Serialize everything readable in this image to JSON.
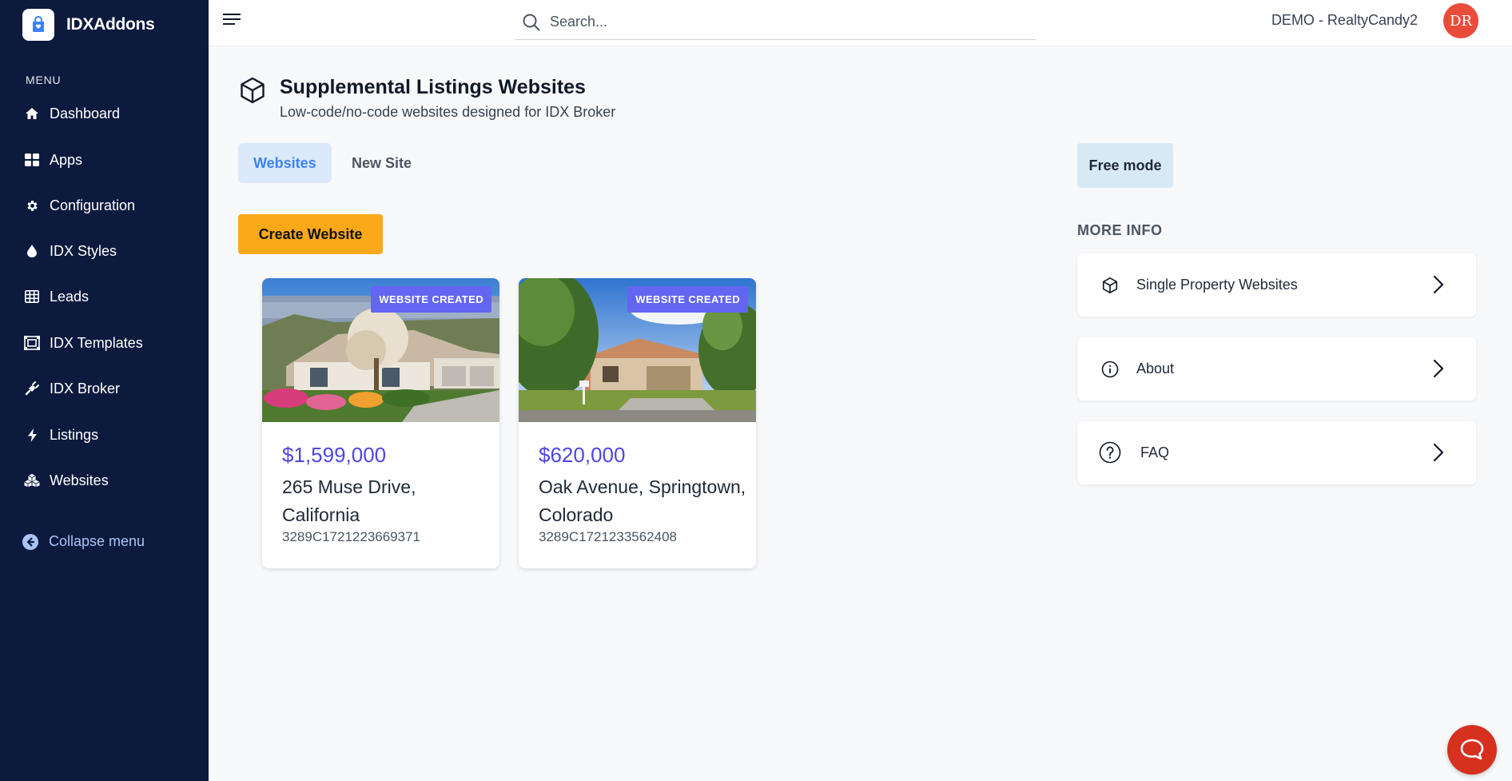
{
  "brand": {
    "name": "IDXAddons"
  },
  "sidebar": {
    "menu_title": "MENU",
    "items": [
      {
        "label": "Dashboard",
        "icon": "home-icon"
      },
      {
        "label": "Apps",
        "icon": "grid-icon"
      },
      {
        "label": "Configuration",
        "icon": "gear-icon"
      },
      {
        "label": "IDX Styles",
        "icon": "droplet-icon"
      },
      {
        "label": "Leads",
        "icon": "table-icon"
      },
      {
        "label": "IDX Templates",
        "icon": "template-icon"
      },
      {
        "label": "IDX Broker",
        "icon": "plug-icon"
      },
      {
        "label": "Listings",
        "icon": "bolt-icon"
      },
      {
        "label": "Websites",
        "icon": "cubes-icon"
      }
    ],
    "collapse_label": "Collapse menu"
  },
  "topbar": {
    "search_placeholder": "Search...",
    "account_name": "DEMO - RealtyCandy2",
    "avatar_initials": "DR"
  },
  "header": {
    "title": "Supplemental Listings Websites",
    "subtitle": "Low-code/no-code websites designed for IDX Broker"
  },
  "tabs": [
    {
      "label": "Websites",
      "active": true
    },
    {
      "label": "New Site",
      "active": false
    }
  ],
  "create_button": "Create Website",
  "cards": [
    {
      "badge": "WEBSITE CREATED",
      "price": "$1,599,000",
      "address": "265 Muse Drive, California",
      "id": "3289C1721223669371"
    },
    {
      "badge": "WEBSITE CREATED",
      "price": "$620,000",
      "address": "Oak Avenue, Springtown, Colorado",
      "id": "3289C1721233562408"
    }
  ],
  "right_panel": {
    "mode_label": "Free mode",
    "more_info_title": "MORE INFO",
    "items": [
      {
        "label": "Single Property Websites",
        "icon": "cube-icon"
      },
      {
        "label": "About",
        "icon": "info-icon"
      },
      {
        "label": "FAQ",
        "icon": "question-icon"
      }
    ]
  },
  "colors": {
    "sidebar_bg": "#0c1a3d",
    "accent": "#3b82f6",
    "price": "#4f46e5",
    "create_button": "#fba919",
    "badge": "#6366f1",
    "chat": "#d6301f"
  }
}
